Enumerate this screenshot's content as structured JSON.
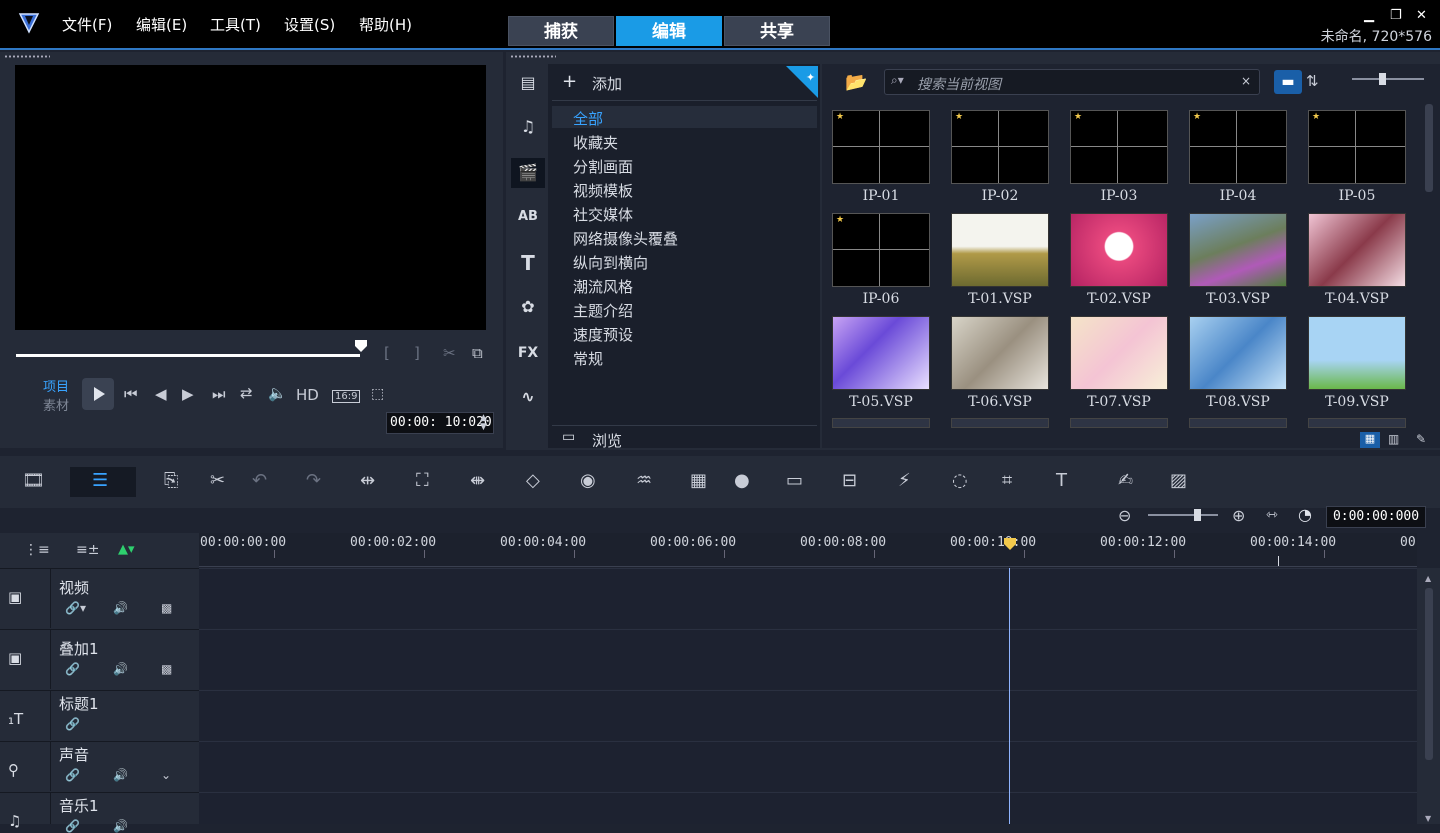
{
  "menu": {
    "file": "文件(F)",
    "edit": "编辑(E)",
    "tools": "工具(T)",
    "settings": "设置(S)",
    "help": "帮助(H)"
  },
  "tabs": {
    "capture": "捕获",
    "edit": "编辑",
    "share": "共享"
  },
  "window": {
    "project_info": "未命名, 720*576"
  },
  "player": {
    "mode_project": "项目",
    "mode_clip": "素材",
    "hd": "HD",
    "aspect": "16:9",
    "timecode": "00:00: 10:020"
  },
  "library": {
    "add_label": "添加",
    "browse_label": "浏览",
    "search_placeholder": "搜索当前视图",
    "categories": [
      "全部",
      "收藏夹",
      "分割画面",
      "视频模板",
      "社交媒体",
      "网络摄像头覆叠",
      "纵向到横向",
      "潮流风格",
      "主题介绍",
      "速度预设",
      "常规"
    ],
    "sidebar_fx": "FX",
    "thumbnails": [
      "IP-01",
      "IP-02",
      "IP-03",
      "IP-04",
      "IP-05",
      "IP-06",
      "T-01.VSP",
      "T-02.VSP",
      "T-03.VSP",
      "T-04.VSP",
      "T-05.VSP",
      "T-06.VSP",
      "T-07.VSP",
      "T-08.VSP",
      "T-09.VSP"
    ]
  },
  "timeline": {
    "zoom_timecode": "0:00:00:000",
    "ruler": [
      "00:00:00:00",
      "00:00:02:00",
      "00:00:04:00",
      "00:00:06:00",
      "00:00:08:00",
      "00:00:10:00",
      "00:00:12:00",
      "00:00:14:00",
      "00"
    ],
    "tracks": [
      "视频",
      "叠加1",
      "标题1",
      "声音",
      "音乐1"
    ]
  },
  "colors": {
    "accent": "#1a9be6",
    "bg": "#1e2330",
    "panel": "#252b38"
  }
}
